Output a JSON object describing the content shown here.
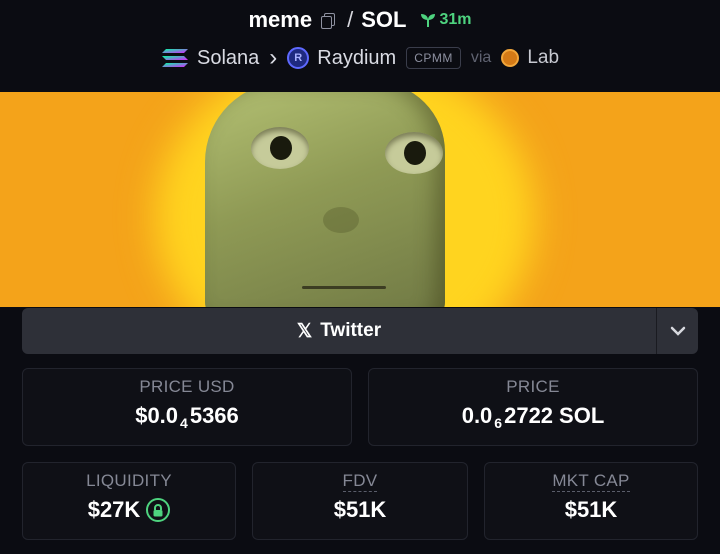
{
  "header": {
    "base_token": "meme",
    "separator": "/",
    "quote_token": "SOL",
    "age": "31m"
  },
  "route": {
    "chain": "Solana",
    "dex": "Raydium",
    "pool_type": "CPMM",
    "via_label": "via",
    "launchpad": "Lab"
  },
  "socials": {
    "twitter_label": "Twitter"
  },
  "stats": {
    "price_usd": {
      "label": "PRICE USD",
      "prefix": "$0.0",
      "zeros": "4",
      "digits": "5366"
    },
    "price_native": {
      "label": "PRICE",
      "prefix": "0.0",
      "zeros": "6",
      "digits": "2722",
      "unit": "SOL"
    },
    "liquidity": {
      "label": "LIQUIDITY",
      "value": "$27K"
    },
    "fdv": {
      "label": "FDV",
      "value": "$51K"
    },
    "mkt_cap": {
      "label": "MKT CAP",
      "value": "$51K"
    }
  },
  "colors": {
    "accent_green": "#4ed37f",
    "banner_orange": "#f4a31a",
    "background": "#0b0c12"
  }
}
